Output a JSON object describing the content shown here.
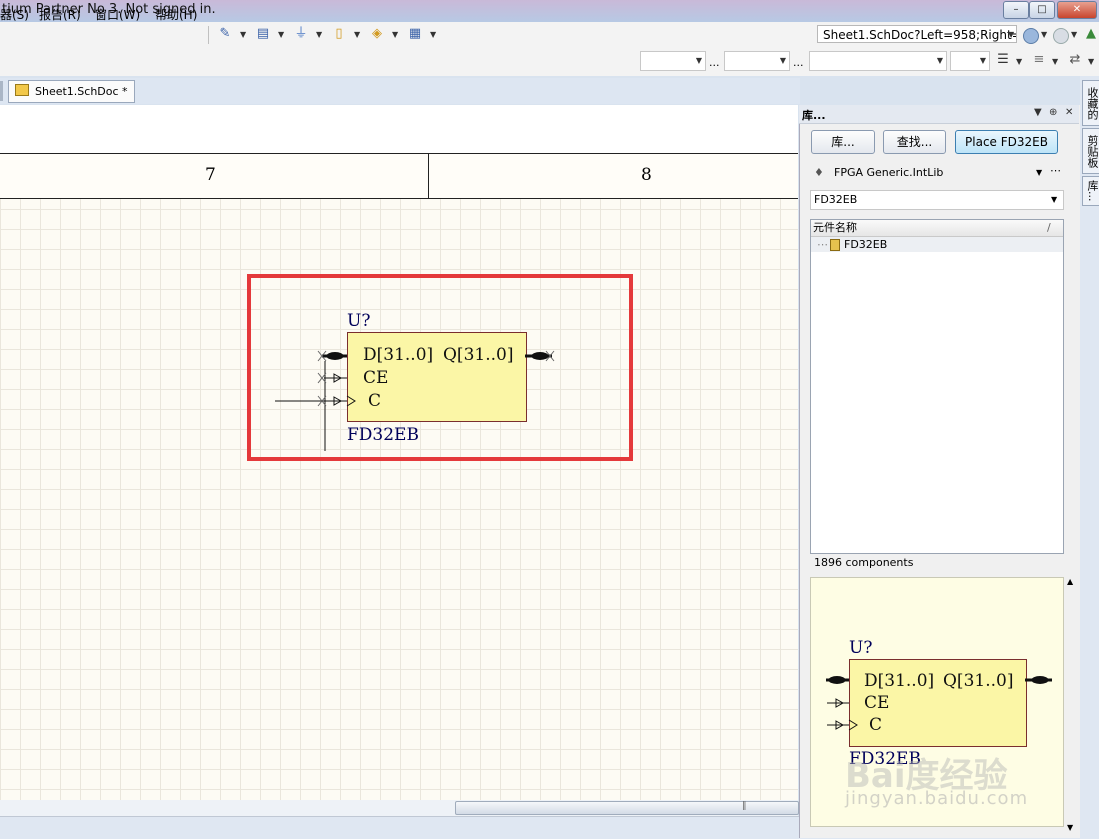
{
  "window": {
    "title": "tium Partner No 3. Not signed in.",
    "controls": [
      "minimize",
      "maximize",
      "close"
    ]
  },
  "menubar": {
    "items": [
      "器(S)",
      "报告(R)",
      "窗口(W)",
      "帮助(H)"
    ],
    "address": "Sheet1.SchDoc?Left=958;Right="
  },
  "toolbar2": {
    "ellipsis": "..."
  },
  "tabs": {
    "document": "Sheet1.SchDoc *"
  },
  "canvas": {
    "zones": [
      "7",
      "8"
    ],
    "component": {
      "designator": "U?",
      "name": "FD32EB",
      "pins_left": [
        "D[31..0]",
        "CE",
        "C"
      ],
      "pins_right": [
        "Q[31..0]"
      ]
    }
  },
  "library_panel": {
    "title": "库...",
    "buttons": {
      "libraries": "库...",
      "search": "查找...",
      "place": "Place FD32EB"
    },
    "selected_library": "FPGA Generic.IntLib",
    "filter": "FD32EB",
    "column_header": "元件名称",
    "sort_indicator": "/",
    "items": [
      "FD32EB"
    ],
    "count": "1896 components",
    "preview": {
      "designator": "U?",
      "name": "FD32EB",
      "pins_left": [
        "D[31..0]",
        "CE",
        "C"
      ],
      "pins_right": [
        "Q[31..0]"
      ]
    }
  },
  "side_tabs": [
    "收藏的",
    "剪贴板",
    "库..."
  ],
  "watermark": {
    "logo": "Bai度经验",
    "url": "jingyan.baidu.com"
  },
  "colors": {
    "highlight": "#e4393b",
    "component_fill": "#fbf6a6",
    "canvas": "#fdfbf4",
    "text_blue": "#00005a"
  }
}
